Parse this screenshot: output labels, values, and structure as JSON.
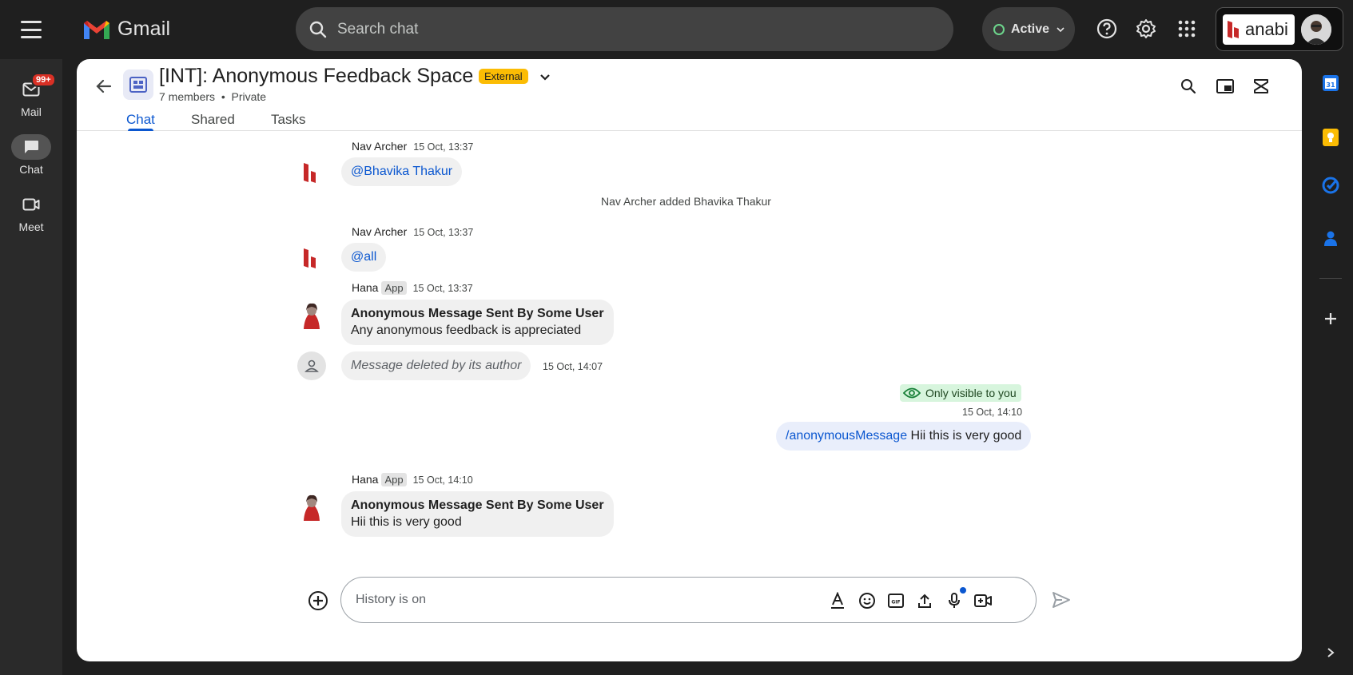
{
  "topbar": {
    "app_name": "Gmail",
    "search_placeholder": "Search chat",
    "status": "Active",
    "account_brand": "anabi"
  },
  "nav": {
    "mail_label": "Mail",
    "mail_badge": "99+",
    "chat_label": "Chat",
    "meet_label": "Meet"
  },
  "space": {
    "title": "[INT]: Anonymous Feedback Space",
    "badge": "External",
    "members": "7 members",
    "separator": "•",
    "privacy": "Private"
  },
  "tabs": [
    "Chat",
    "Shared",
    "Tasks"
  ],
  "messages": {
    "m1": {
      "sender": "Nav Archer",
      "time": "15 Oct, 13:37",
      "text": "@Bhavika Thakur"
    },
    "system1": "Nav Archer added Bhavika Thakur",
    "m2": {
      "sender": "Nav Archer",
      "time": "15 Oct, 13:37",
      "text": "@all"
    },
    "m3": {
      "sender": "Hana",
      "tag": "App",
      "time": "15 Oct, 13:37",
      "title": "Anonymous Message Sent By Some User",
      "text": "Any anonymous feedback is appreciated"
    },
    "m4": {
      "text": "Message deleted by its author",
      "time": "15 Oct, 14:07"
    },
    "m5": {
      "visibility": "Only visible to you",
      "time": "15 Oct, 14:10",
      "command": "/anonymousMessage",
      "text": "Hii this is very good"
    },
    "m6": {
      "sender": "Hana",
      "tag": "App",
      "time": "15 Oct, 14:10",
      "title": "Anonymous Message Sent By Some User",
      "text": "Hii this is very good"
    }
  },
  "composer": {
    "placeholder": "History is on"
  },
  "colors": {
    "accent": "#0b57d0",
    "external_badge": "#fbbc04",
    "active_dot": "#6dd58c",
    "visible_badge": "#d7f5dd"
  }
}
